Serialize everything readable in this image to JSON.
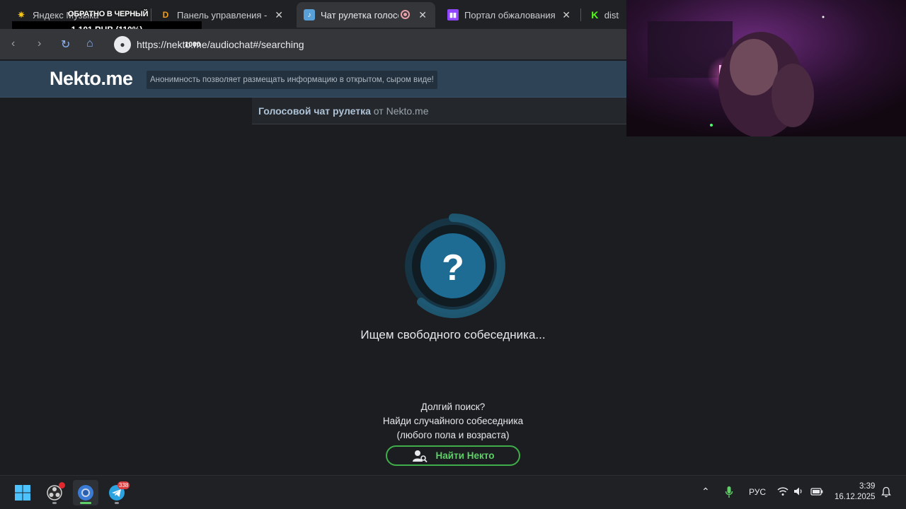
{
  "tabs": [
    {
      "title": "Яндекс Музыка",
      "icon": "yandex-music-icon",
      "color": "#f5c518"
    },
    {
      "title": "Панель управления - D",
      "icon": "donation-panel-icon",
      "color": "#f59b1c"
    },
    {
      "title": "Чат рулетка голосо",
      "icon": "nekto-icon",
      "color": "#5aa0d8"
    },
    {
      "title": "Портал обжалования -",
      "icon": "twitch-icon",
      "color": "#9146ff"
    },
    {
      "title": "distru",
      "icon": "kick-icon",
      "color": "#53fc18"
    }
  ],
  "overlay": {
    "title": "ОБРАТНО В ЧЕРНЫЙ",
    "amount": "1 101 RUB (110%)"
  },
  "toolbar": {
    "url": "https://nekto.me/audiochat#/searching",
    "tooltip": "1000"
  },
  "site": {
    "logo": "Nekto.me",
    "slogan": "Анонимность позволяет размещать информацию в открытом, сыром виде!",
    "subtitle_strong": "Голосовой чат рулетка",
    "subtitle_rest": " от Nekto.me"
  },
  "main": {
    "searching_symbol": "?",
    "searching_text": "Ищем свободного собеседника...",
    "long_search_line1": "Долгий поиск?",
    "long_search_line2": "Найди случайного собеседника",
    "long_search_line3": "(любого пола и возраста)",
    "find_button": "Найти Некто",
    "accent": "#5fd068"
  },
  "taskbar": {
    "telegram_badge": "338",
    "lang": "РУС",
    "time": "3:39",
    "date": "16.12.2025"
  }
}
